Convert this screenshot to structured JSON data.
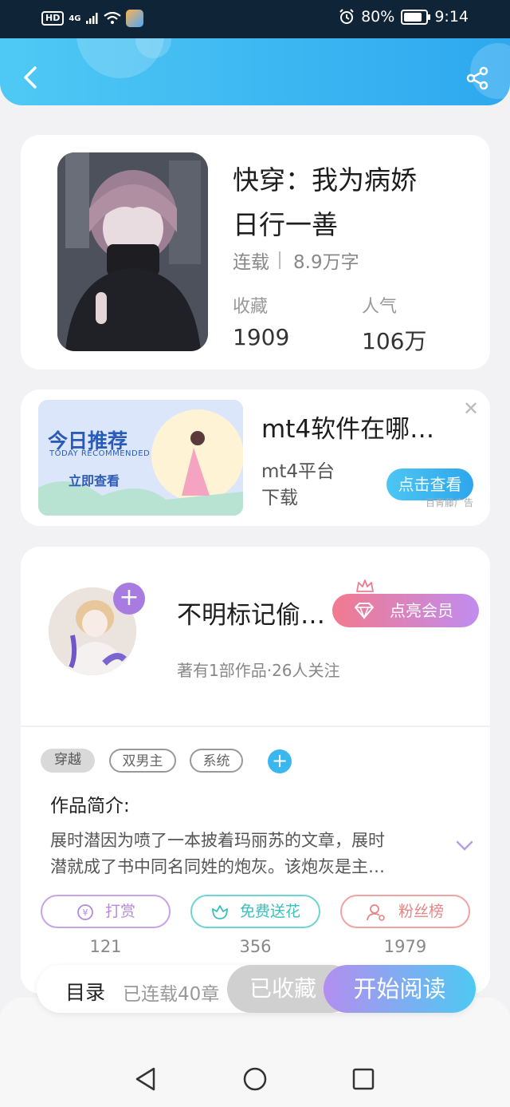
{
  "status_bar": {
    "left_hd": "HD",
    "network": "4G",
    "battery_pct": "80%",
    "time": "9:14"
  },
  "header": {
    "back_icon": "chevron-left-icon",
    "share_icon": "share-icon"
  },
  "book": {
    "title_line1": "快穿：我为病娇",
    "title_line2": "日行一善",
    "status": "连载",
    "word_count": "8.9万字",
    "collect_label": "收藏",
    "collect_value": "1909",
    "popularity_label": "人气",
    "popularity_value": "106万"
  },
  "ad": {
    "image_title": "今日推荐",
    "image_subtitle": "TODAY RECOMMENDED",
    "image_cta": "立即查看",
    "title": "mt4软件在哪…",
    "subtitle_line1": "mt4平台",
    "subtitle_line2": "下载",
    "button": "点击查看",
    "source": "百青藤广告"
  },
  "author": {
    "name": "不明标记偷…",
    "follow_plus": "+",
    "vip_button": "点亮会员",
    "info": "著有1部作品·26人关注"
  },
  "tags": [
    "穿越",
    "双男主",
    "系统"
  ],
  "intro": {
    "heading": "作品简介:",
    "line1": "展时潜因为喷了一本披着玛丽苏的文章，展时",
    "line2": "潜就成了书中同名同姓的炮灰。该炮灰是主…"
  },
  "actions": [
    {
      "label": "打赏",
      "count": "121",
      "icon": "coin-icon"
    },
    {
      "label": "免费送花",
      "count": "356",
      "icon": "flower-icon"
    },
    {
      "label": "粉丝榜",
      "count": "1979",
      "icon": "user-icon"
    }
  ],
  "bottom_bar": {
    "toc": "目录",
    "chapters": "已连载40章",
    "collected": "已收藏",
    "read": "开始阅读"
  },
  "colors": {
    "header_start": "#4fc9f4",
    "header_end": "#2ea8ef",
    "accent_purple": "#a77be0"
  }
}
